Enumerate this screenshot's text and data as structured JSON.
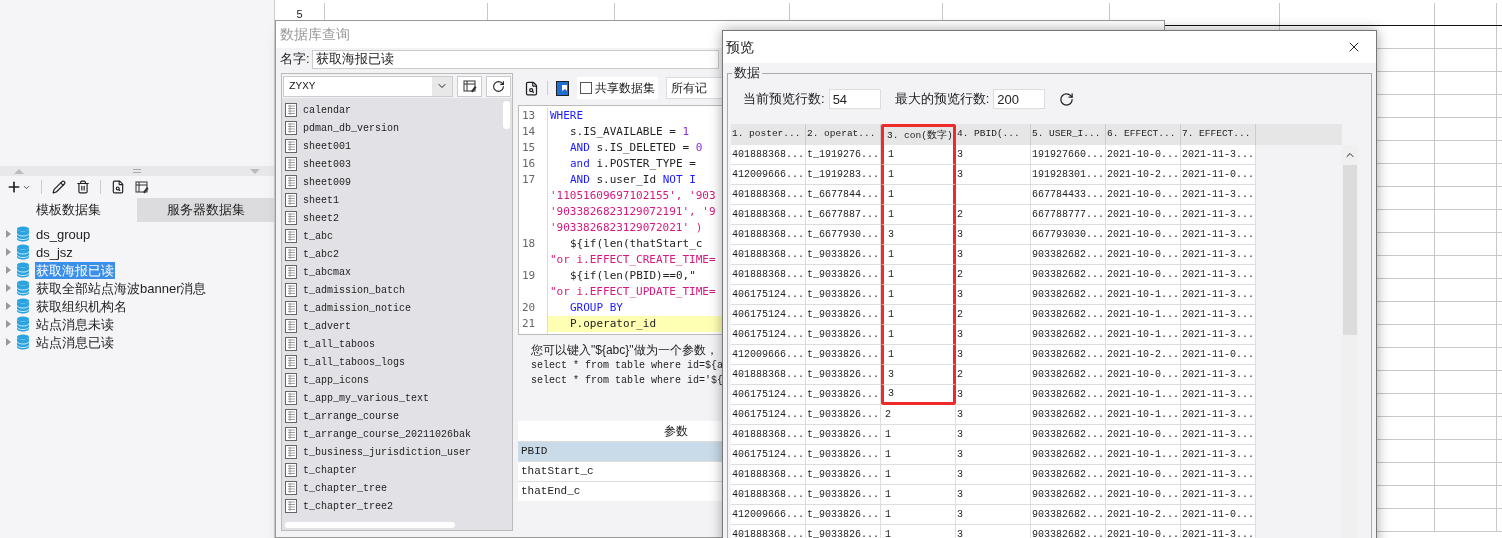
{
  "sheet": {
    "row_label": "5"
  },
  "left_panel": {
    "tabs": [
      {
        "label": "模板数据集",
        "selected": true
      },
      {
        "label": "服务器数据集",
        "selected": false
      }
    ],
    "tree": [
      {
        "label": "ds_group",
        "selected": false
      },
      {
        "label": "ds_jsz",
        "selected": false
      },
      {
        "label": "获取海报已读",
        "selected": true
      },
      {
        "label": "获取全部站点海波banner消息",
        "selected": false
      },
      {
        "label": "获取组织机构名",
        "selected": false
      },
      {
        "label": "站点消息未读",
        "selected": false
      },
      {
        "label": "站点消息已读",
        "selected": false
      }
    ]
  },
  "query_dialog": {
    "title": "数据库查询",
    "name_label": "名字:",
    "name_value": "获取海报已读",
    "connection": "ZYXY",
    "tables": [
      "calendar",
      "pdman_db_version",
      "sheet001",
      "sheet003",
      "sheet009",
      "sheet1",
      "sheet2",
      "t_abc",
      "t_abc2",
      "t_abcmax",
      "t_admission_batch",
      "t_admission_notice",
      "t_advert",
      "t_all_taboos",
      "t_all_taboos_logs",
      "t_app_icons",
      "t_app_my_various_text",
      "t_arrange_course",
      "t_arrange_course_20211026bak",
      "t_business_jurisdiction_user",
      "t_chapter",
      "t_chapter_tree",
      "t_chapter_tree2"
    ],
    "share_checkbox": {
      "label": "共享数据集",
      "checked": false
    },
    "records_button": "所有记",
    "sql": [
      {
        "no": "13",
        "indent": false,
        "highlighted": false,
        "segs": [
          {
            "kind": "keyword",
            "text": "WHERE"
          }
        ]
      },
      {
        "no": "14",
        "indent": true,
        "highlighted": false,
        "segs": [
          {
            "kind": "plain",
            "text": "s.IS_AVAILABLE = "
          },
          {
            "kind": "number",
            "text": "1"
          }
        ]
      },
      {
        "no": "15",
        "indent": true,
        "highlighted": false,
        "segs": [
          {
            "kind": "keyword",
            "text": "AND"
          },
          {
            "kind": "plain",
            "text": " s.IS_DELETED = "
          },
          {
            "kind": "number",
            "text": "0"
          }
        ]
      },
      {
        "no": "16",
        "indent": true,
        "highlighted": false,
        "segs": [
          {
            "kind": "keyword",
            "text": "and"
          },
          {
            "kind": "plain",
            "text": " i.POSTER_TYPE ="
          }
        ]
      },
      {
        "no": "17",
        "indent": true,
        "highlighted": false,
        "segs": [
          {
            "kind": "keyword",
            "text": "AND"
          },
          {
            "kind": "plain",
            "text": " s.user_Id "
          },
          {
            "kind": "keyword",
            "text": "NOT I"
          }
        ]
      },
      {
        "indent": false,
        "highlighted": false,
        "segs": [
          {
            "kind": "string",
            "text": "'11051609697102155', '903"
          }
        ]
      },
      {
        "indent": false,
        "highlighted": false,
        "segs": [
          {
            "kind": "string",
            "text": "'9033826823129072191', '9"
          }
        ]
      },
      {
        "indent": false,
        "highlighted": false,
        "segs": [
          {
            "kind": "string",
            "text": "'9033826823129072021' )"
          }
        ]
      },
      {
        "no": "18",
        "indent": true,
        "highlighted": false,
        "segs": [
          {
            "kind": "plain",
            "text": "${if(len(thatStart_c"
          }
        ]
      },
      {
        "indent": false,
        "highlighted": false,
        "segs": [
          {
            "kind": "string",
            "text": "\"or i.EFFECT_CREATE_TIME="
          }
        ]
      },
      {
        "no": "19",
        "indent": true,
        "highlighted": false,
        "segs": [
          {
            "kind": "plain",
            "text": "${if(len(PBID)==0,\""
          }
        ]
      },
      {
        "indent": false,
        "highlighted": false,
        "segs": [
          {
            "kind": "string",
            "text": "\"or i.EFFECT_UPDATE_TIME="
          }
        ]
      },
      {
        "no": "20",
        "indent": true,
        "highlighted": false,
        "segs": [
          {
            "kind": "keyword",
            "text": "GROUP BY"
          }
        ]
      },
      {
        "no": "21",
        "indent": true,
        "highlighted": true,
        "segs": [
          {
            "kind": "plain",
            "text": "P.operator_id"
          }
        ]
      }
    ],
    "help": [
      "您可以键入\"${abc}\"做为一个参数，",
      "select * from table where id=${a",
      "select * from table where id='${"
    ],
    "params_header": "参数",
    "params": [
      {
        "name": "PBID",
        "selected": true
      },
      {
        "name": "thatStart_c",
        "selected": false
      },
      {
        "name": "thatEnd_c",
        "selected": false
      }
    ]
  },
  "preview": {
    "title": "预览",
    "group": "数据",
    "current_label": "当前预览行数:",
    "current_value": "54",
    "max_label": "最大的预览行数:",
    "max_value": "200",
    "columns": [
      {
        "label": "1. poster...",
        "highlighted": false
      },
      {
        "label": "2. operat...",
        "highlighted": false
      },
      {
        "label": "3. con(数字)",
        "highlighted": true
      },
      {
        "label": "4. PBID(...",
        "highlighted": false
      },
      {
        "label": "5. USER_I...",
        "highlighted": false
      },
      {
        "label": "6. EFFECT...",
        "highlighted": false
      },
      {
        "label": "7. EFFECT...",
        "highlighted": false
      }
    ],
    "rows": [
      {
        "marked": true,
        "cells": [
          "401888368...",
          "t_1919276...",
          "1",
          "3",
          "191927660...",
          "2021-10-0...",
          "2021-11-3..."
        ]
      },
      {
        "marked": true,
        "cells": [
          "412009666...",
          "t_1919283...",
          "1",
          "3",
          "191928301...",
          "2021-10-2...",
          "2021-11-0..."
        ]
      },
      {
        "marked": true,
        "cells": [
          "401888368...",
          "t_6677844...",
          "1",
          null,
          "667784433...",
          "2021-10-0...",
          "2021-11-3..."
        ]
      },
      {
        "marked": true,
        "cells": [
          "401888368...",
          "t_6677887...",
          "1",
          "2",
          "667788777...",
          "2021-10-0...",
          "2021-11-3..."
        ]
      },
      {
        "marked": true,
        "cells": [
          "401888368...",
          "t_6677930...",
          "3",
          "3",
          "667793030...",
          "2021-10-0...",
          "2021-11-3..."
        ]
      },
      {
        "marked": true,
        "cells": [
          "401888368...",
          "t_9033826...",
          "1",
          "3",
          "903382682...",
          "2021-10-0...",
          "2021-11-3..."
        ]
      },
      {
        "marked": true,
        "cells": [
          "401888368...",
          "t_9033826...",
          "1",
          "2",
          "903382682...",
          "2021-10-0...",
          "2021-11-3..."
        ]
      },
      {
        "marked": true,
        "cells": [
          "406175124...",
          "t_9033826...",
          "1",
          "3",
          "903382682...",
          "2021-10-1...",
          "2021-11-3..."
        ]
      },
      {
        "marked": true,
        "cells": [
          "406175124...",
          "t_9033826...",
          "1",
          "2",
          "903382682...",
          "2021-10-1...",
          "2021-11-3..."
        ]
      },
      {
        "marked": true,
        "cells": [
          "406175124...",
          "t_9033826...",
          "1",
          "3",
          "903382682...",
          "2021-10-1...",
          "2021-11-3..."
        ]
      },
      {
        "marked": true,
        "cells": [
          "412009666...",
          "t_9033826...",
          "1",
          "3",
          "903382682...",
          "2021-10-2...",
          "2021-11-0..."
        ]
      },
      {
        "marked": true,
        "cells": [
          "401888368...",
          "t_9033826...",
          "3",
          "2",
          "903382682...",
          "2021-10-0...",
          "2021-11-3..."
        ]
      },
      {
        "marked": true,
        "cells": [
          "406175124...",
          "t_9033826...",
          "3",
          "3",
          "903382682...",
          "2021-10-1...",
          "2021-11-3..."
        ]
      },
      {
        "marked": false,
        "cells": [
          "406175124...",
          "t_9033826...",
          "2",
          "3",
          "903382682...",
          "2021-10-1...",
          "2021-11-3..."
        ]
      },
      {
        "marked": false,
        "cells": [
          "401888368...",
          "t_9033826...",
          "1",
          "3",
          "903382682...",
          "2021-10-0...",
          "2021-11-3..."
        ]
      },
      {
        "marked": false,
        "cells": [
          "406175124...",
          "t_9033826...",
          "1",
          "3",
          "903382682...",
          "2021-10-1...",
          "2021-11-3..."
        ]
      },
      {
        "marked": false,
        "cells": [
          "401888368...",
          "t_9033826...",
          "1",
          "3",
          "903382682...",
          "2021-10-0...",
          "2021-11-3..."
        ]
      },
      {
        "marked": false,
        "cells": [
          "401888368...",
          "t_9033826...",
          "1",
          "3",
          "903382682...",
          "2021-10-0...",
          "2021-11-3..."
        ]
      },
      {
        "marked": false,
        "cells": [
          "412009666...",
          "t_9033826...",
          "1",
          "3",
          "903382682...",
          "2021-10-2...",
          "2021-11-0..."
        ]
      },
      {
        "marked": false,
        "cells": [
          "401888368...",
          "t_9033826...",
          "1",
          "3",
          "903382682...",
          "2021-10-0...",
          "2021-11-3..."
        ]
      }
    ]
  }
}
